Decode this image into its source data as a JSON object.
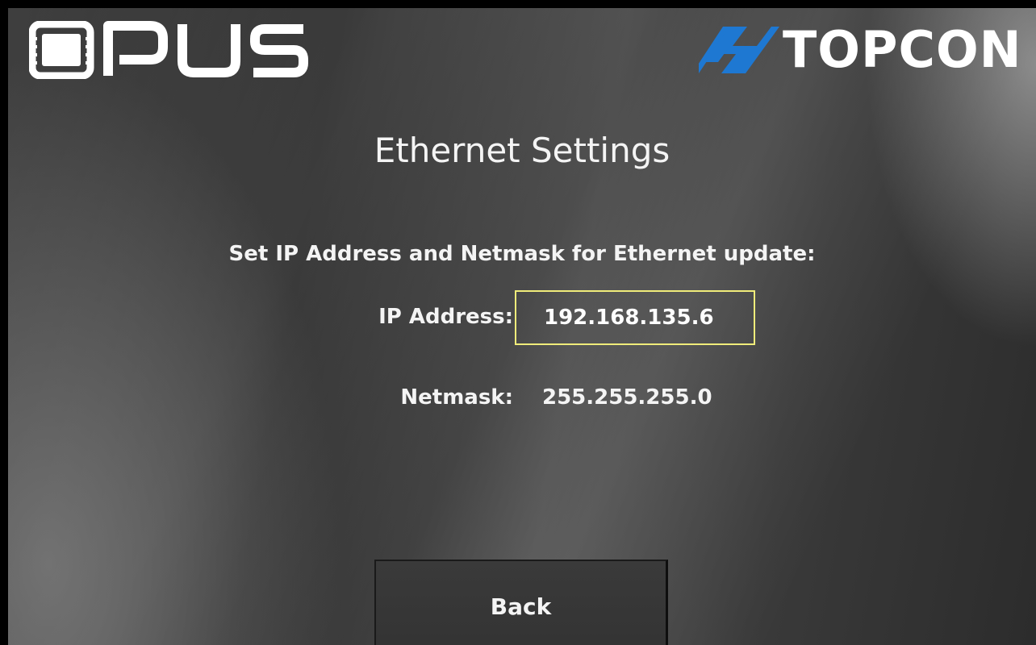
{
  "brand": {
    "left_logo_text": "OPUS",
    "right_logo_text": "TOPCON",
    "topcon_blue": "#1e78d2",
    "highlight_color": "#f0ec7a"
  },
  "screen": {
    "title": "Ethernet Settings",
    "instruction": "Set IP Address and Netmask for Ethernet update:"
  },
  "fields": {
    "ip_label": "IP Address:",
    "ip_value": "192.168.135.6",
    "netmask_label": "Netmask:",
    "netmask_value": "255.255.255.0"
  },
  "buttons": {
    "back_label": "Back"
  }
}
